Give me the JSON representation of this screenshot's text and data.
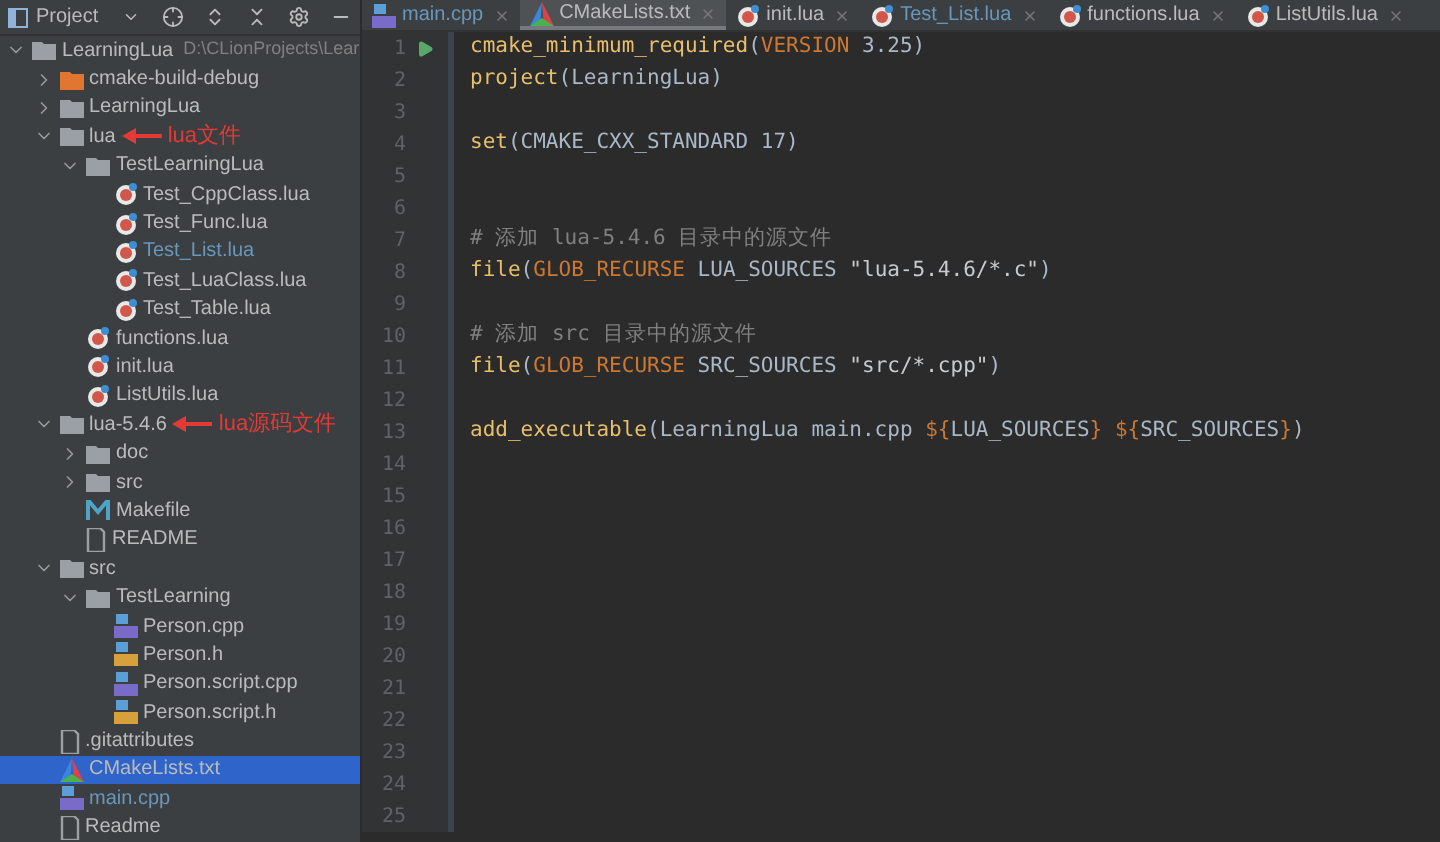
{
  "project_panel": {
    "title": "Project"
  },
  "tree": [
    {
      "name": "LearningLua",
      "path": "D:\\CLionProjects\\Lear",
      "kind": "folder",
      "expanded": true,
      "selected": false,
      "changed": false,
      "children": [
        {
          "name": "cmake-build-debug",
          "kind": "excluded-folder",
          "expanded": false,
          "selected": false,
          "changed": false
        },
        {
          "name": "LearningLua",
          "kind": "folder",
          "expanded": false,
          "selected": false,
          "changed": false
        },
        {
          "name": "lua",
          "kind": "folder",
          "expanded": true,
          "selected": false,
          "changed": false,
          "annotation": "lua文件",
          "children": [
            {
              "name": "TestLearningLua",
              "kind": "folder",
              "expanded": true,
              "selected": false,
              "changed": false,
              "children": [
                {
                  "name": "Test_CppClass.lua",
                  "kind": "lua",
                  "selected": false,
                  "changed": false
                },
                {
                  "name": "Test_Func.lua",
                  "kind": "lua",
                  "selected": false,
                  "changed": false
                },
                {
                  "name": "Test_List.lua",
                  "kind": "lua",
                  "selected": false,
                  "changed": true
                },
                {
                  "name": "Test_LuaClass.lua",
                  "kind": "lua",
                  "selected": false,
                  "changed": false
                },
                {
                  "name": "Test_Table.lua",
                  "kind": "lua",
                  "selected": false,
                  "changed": false
                }
              ]
            },
            {
              "name": "functions.lua",
              "kind": "lua",
              "selected": false,
              "changed": false
            },
            {
              "name": "init.lua",
              "kind": "lua",
              "selected": false,
              "changed": false
            },
            {
              "name": "ListUtils.lua",
              "kind": "lua",
              "selected": false,
              "changed": false
            }
          ]
        },
        {
          "name": "lua-5.4.6",
          "kind": "folder",
          "expanded": true,
          "selected": false,
          "changed": false,
          "annotation": "lua源码文件",
          "children": [
            {
              "name": "doc",
              "kind": "folder",
              "expanded": false,
              "selected": false,
              "changed": false
            },
            {
              "name": "src",
              "kind": "folder",
              "expanded": false,
              "selected": false,
              "changed": false
            },
            {
              "name": "Makefile",
              "kind": "makefile",
              "selected": false,
              "changed": false
            },
            {
              "name": "README",
              "kind": "text",
              "selected": false,
              "changed": false
            }
          ]
        },
        {
          "name": "src",
          "kind": "folder",
          "expanded": true,
          "selected": false,
          "changed": false,
          "children": [
            {
              "name": "TestLearning",
              "kind": "folder",
              "expanded": true,
              "selected": false,
              "changed": false,
              "children": [
                {
                  "name": "Person.cpp",
                  "kind": "cpp",
                  "selected": false,
                  "changed": false
                },
                {
                  "name": "Person.h",
                  "kind": "header",
                  "selected": false,
                  "changed": false
                },
                {
                  "name": "Person.script.cpp",
                  "kind": "cpp",
                  "selected": false,
                  "changed": false
                },
                {
                  "name": "Person.script.h",
                  "kind": "header",
                  "selected": false,
                  "changed": false
                }
              ]
            }
          ]
        },
        {
          "name": ".gitattributes",
          "kind": "text",
          "selected": false,
          "changed": false
        },
        {
          "name": "CMakeLists.txt",
          "kind": "cmake",
          "selected": true,
          "changed": false
        },
        {
          "name": "main.cpp",
          "kind": "cpp",
          "selected": false,
          "changed": true
        },
        {
          "name": "Readme",
          "kind": "text",
          "selected": false,
          "changed": false
        }
      ]
    }
  ],
  "tabs": [
    {
      "label": "main.cpp",
      "kind": "cpp",
      "selected": false,
      "changed": true
    },
    {
      "label": "CMakeLists.txt",
      "kind": "cmake",
      "selected": true,
      "changed": false
    },
    {
      "label": "init.lua",
      "kind": "lua",
      "selected": false,
      "changed": false
    },
    {
      "label": "Test_List.lua",
      "kind": "lua",
      "selected": false,
      "changed": true
    },
    {
      "label": "functions.lua",
      "kind": "lua",
      "selected": false,
      "changed": false
    },
    {
      "label": "ListUtils.lua",
      "kind": "lua",
      "selected": false,
      "changed": false
    }
  ],
  "code": [
    {
      "number": "1",
      "run_marker": true,
      "tokens": [
        {
          "text": "cmake_minimum_required",
          "kind": "command"
        },
        {
          "text": "(",
          "kind": "plain"
        },
        {
          "text": "VERSION",
          "kind": "keyword"
        },
        {
          "text": " 3.25)",
          "kind": "plain"
        }
      ]
    },
    {
      "number": "2",
      "run_marker": false,
      "tokens": [
        {
          "text": "project",
          "kind": "command"
        },
        {
          "text": "(LearningLua)",
          "kind": "plain"
        }
      ]
    },
    {
      "number": "3",
      "run_marker": false
    },
    {
      "number": "4",
      "run_marker": false,
      "tokens": [
        {
          "text": "set",
          "kind": "command"
        },
        {
          "text": "(CMAKE_CXX_STANDARD 17)",
          "kind": "plain"
        }
      ]
    },
    {
      "number": "5",
      "run_marker": false
    },
    {
      "number": "6",
      "run_marker": false
    },
    {
      "number": "7",
      "run_marker": false,
      "tokens": [
        {
          "text": "# 添加 lua-5.4.6 目录中的源文件",
          "kind": "comment"
        }
      ]
    },
    {
      "number": "8",
      "run_marker": false,
      "tokens": [
        {
          "text": "file",
          "kind": "command"
        },
        {
          "text": "(",
          "kind": "plain"
        },
        {
          "text": "GLOB_RECURSE",
          "kind": "keyword"
        },
        {
          "text": " LUA_SOURCES ",
          "kind": "plain"
        },
        {
          "text": "\"lua-5.4.6/*.c\"",
          "kind": "string"
        },
        {
          "text": ")",
          "kind": "plain"
        }
      ]
    },
    {
      "number": "9",
      "run_marker": false
    },
    {
      "number": "10",
      "run_marker": false,
      "tokens": [
        {
          "text": "# 添加 src 目录中的源文件",
          "kind": "comment"
        }
      ]
    },
    {
      "number": "11",
      "run_marker": false,
      "tokens": [
        {
          "text": "file",
          "kind": "command"
        },
        {
          "text": "(",
          "kind": "plain"
        },
        {
          "text": "GLOB_RECURSE",
          "kind": "keyword"
        },
        {
          "text": " SRC_SOURCES ",
          "kind": "plain"
        },
        {
          "text": "\"src/*.cpp\"",
          "kind": "string"
        },
        {
          "text": ")",
          "kind": "plain"
        }
      ]
    },
    {
      "number": "12",
      "run_marker": false
    },
    {
      "number": "13",
      "run_marker": false,
      "tokens": [
        {
          "text": "add_executable",
          "kind": "command"
        },
        {
          "text": "(LearningLua main.cpp ",
          "kind": "plain"
        },
        {
          "text": "${",
          "kind": "keyword"
        },
        {
          "text": "LUA_SOURCES",
          "kind": "plain"
        },
        {
          "text": "}",
          "kind": "keyword"
        },
        {
          "text": " ${",
          "kind": "keyword"
        },
        {
          "text": "SRC_SOURCES",
          "kind": "plain"
        },
        {
          "text": "}",
          "kind": "keyword"
        },
        {
          "text": ")",
          "kind": "plain"
        }
      ]
    },
    {
      "number": "14",
      "run_marker": false
    },
    {
      "number": "15",
      "run_marker": false
    },
    {
      "number": "16",
      "run_marker": false
    },
    {
      "number": "17",
      "run_marker": false
    },
    {
      "number": "18",
      "run_marker": false
    },
    {
      "number": "19",
      "run_marker": false
    },
    {
      "number": "20",
      "run_marker": false
    },
    {
      "number": "21",
      "run_marker": false
    },
    {
      "number": "22",
      "run_marker": false
    },
    {
      "number": "23",
      "run_marker": false
    },
    {
      "number": "24",
      "run_marker": false
    },
    {
      "number": "25",
      "run_marker": false
    }
  ]
}
